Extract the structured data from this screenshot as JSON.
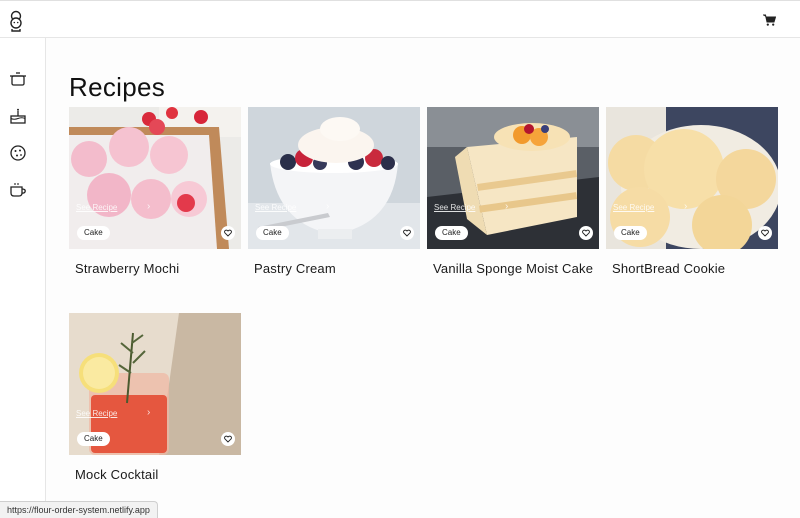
{
  "header": {
    "logo_icon": "chef-icon",
    "cart_icon": "cart-icon"
  },
  "sidebar": {
    "items": [
      {
        "icon": "pot-icon"
      },
      {
        "icon": "cake-icon"
      },
      {
        "icon": "cookie-icon"
      },
      {
        "icon": "cup-icon"
      }
    ]
  },
  "main": {
    "title": "Recipes",
    "see_recipe_label": "See Recipe",
    "recipes": [
      {
        "name": "Strawberry Mochi",
        "category": "Cake"
      },
      {
        "name": "Pastry Cream",
        "category": "Cake"
      },
      {
        "name": "Vanilla Sponge Moist Cake",
        "category": "Cake"
      },
      {
        "name": "ShortBread Cookie",
        "category": "Cake"
      },
      {
        "name": "Mock Cocktail",
        "category": "Cake"
      }
    ]
  },
  "status_bar": {
    "url": "https://flour-order-system.netlify.app"
  }
}
